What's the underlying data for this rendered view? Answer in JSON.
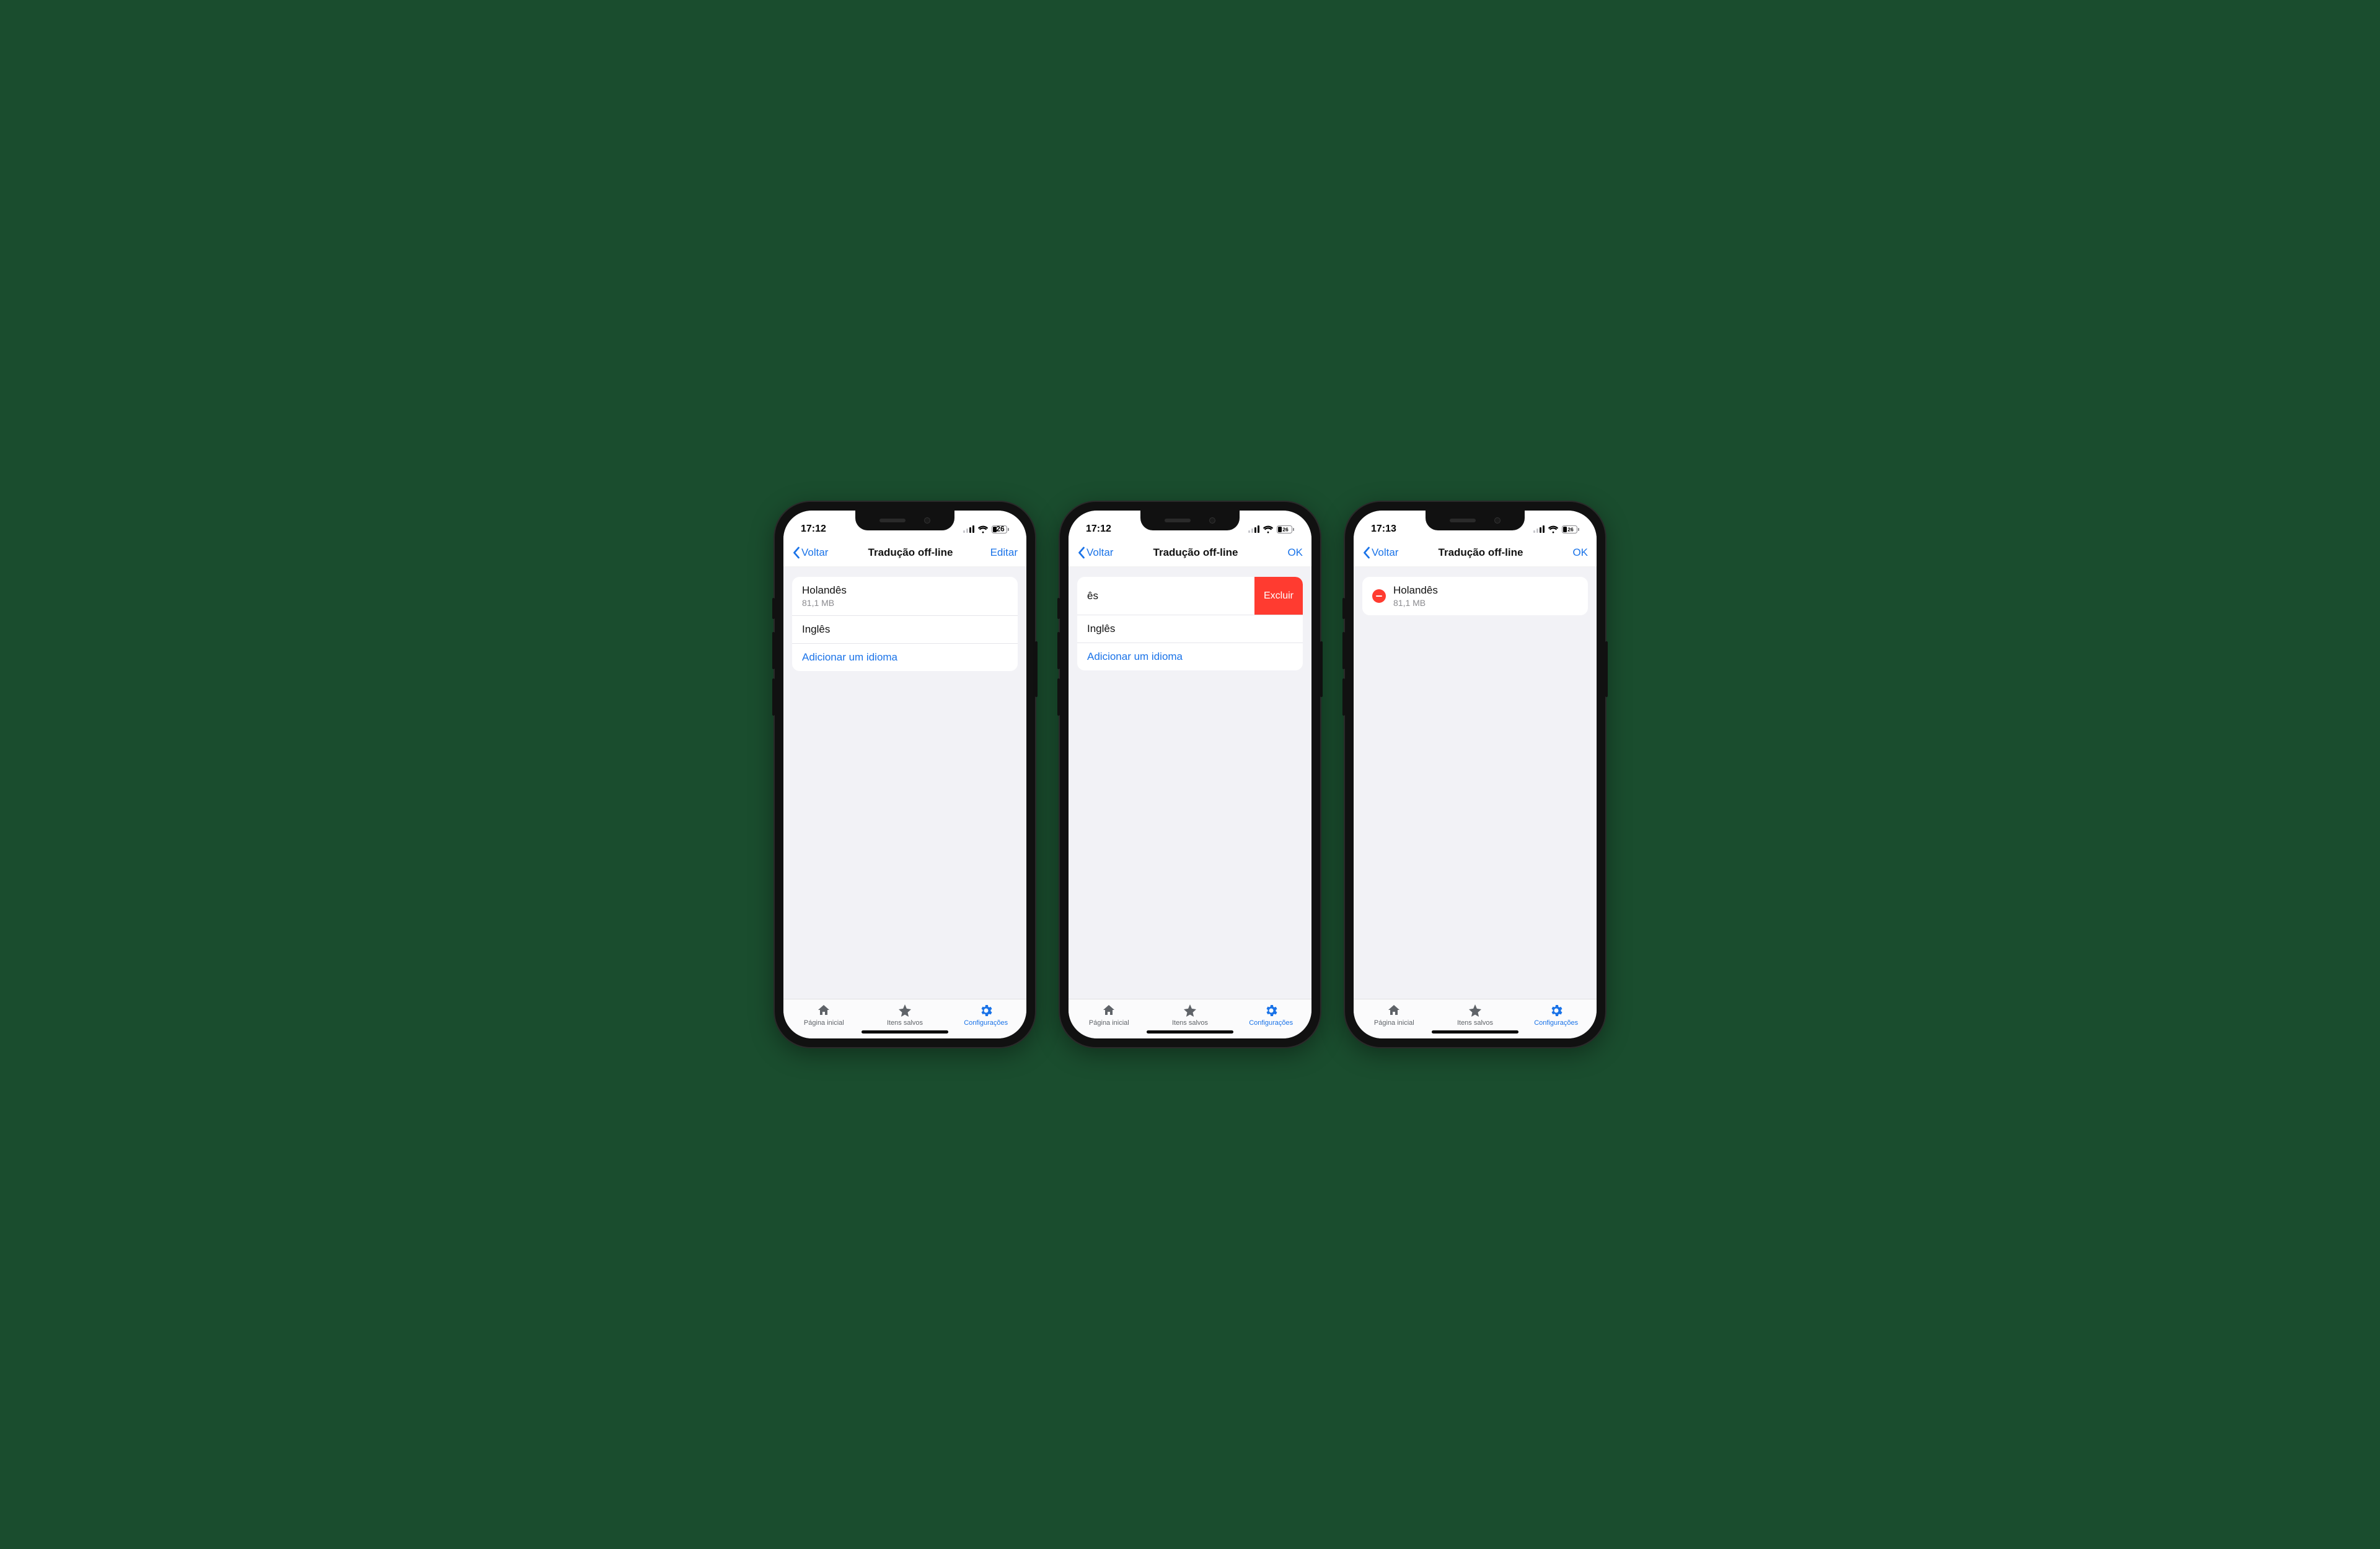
{
  "colors": {
    "accent": "#1a73e8",
    "danger": "#ff3b30"
  },
  "tabbar": {
    "items": [
      {
        "label": "Página inicial"
      },
      {
        "label": "Itens salvos"
      },
      {
        "label": "Configurações"
      }
    ]
  },
  "phones": [
    {
      "status": {
        "time": "17:12",
        "battery": "26"
      },
      "nav": {
        "back": "Voltar",
        "title": "Tradução off-line",
        "right": "Editar"
      },
      "rows": [
        {
          "name": "Holandês",
          "sub": "81,1 MB"
        },
        {
          "name": "Inglês"
        }
      ],
      "add_label": "Adicionar um idioma"
    },
    {
      "status": {
        "time": "17:12",
        "battery": "26"
      },
      "nav": {
        "back": "Voltar",
        "title": "Tradução off-line",
        "right": "OK"
      },
      "swiped_fragment": "ês",
      "delete_label": "Excluir",
      "rows": [
        {
          "name": "Inglês"
        }
      ],
      "add_label": "Adicionar um idioma"
    },
    {
      "status": {
        "time": "17:13",
        "battery": "26"
      },
      "nav": {
        "back": "Voltar",
        "title": "Tradução off-line",
        "right": "OK"
      },
      "edit_rows": [
        {
          "name": "Holandês",
          "sub": "81,1 MB"
        }
      ]
    }
  ]
}
